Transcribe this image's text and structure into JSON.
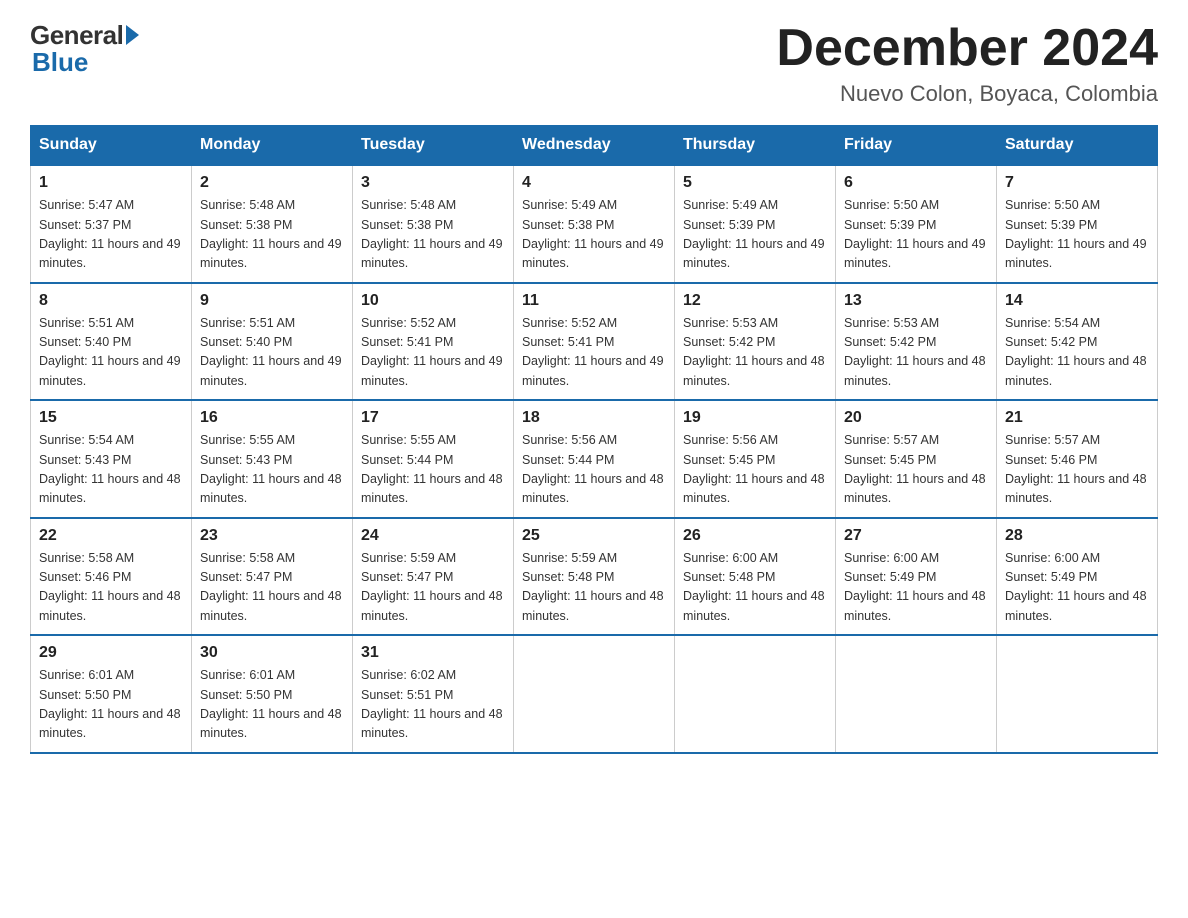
{
  "logo": {
    "general": "General",
    "blue": "Blue"
  },
  "title": "December 2024",
  "location": "Nuevo Colon, Boyaca, Colombia",
  "days_of_week": [
    "Sunday",
    "Monday",
    "Tuesday",
    "Wednesday",
    "Thursday",
    "Friday",
    "Saturday"
  ],
  "weeks": [
    [
      {
        "day": "1",
        "sunrise": "5:47 AM",
        "sunset": "5:37 PM",
        "daylight": "11 hours and 49 minutes."
      },
      {
        "day": "2",
        "sunrise": "5:48 AM",
        "sunset": "5:38 PM",
        "daylight": "11 hours and 49 minutes."
      },
      {
        "day": "3",
        "sunrise": "5:48 AM",
        "sunset": "5:38 PM",
        "daylight": "11 hours and 49 minutes."
      },
      {
        "day": "4",
        "sunrise": "5:49 AM",
        "sunset": "5:38 PM",
        "daylight": "11 hours and 49 minutes."
      },
      {
        "day": "5",
        "sunrise": "5:49 AM",
        "sunset": "5:39 PM",
        "daylight": "11 hours and 49 minutes."
      },
      {
        "day": "6",
        "sunrise": "5:50 AM",
        "sunset": "5:39 PM",
        "daylight": "11 hours and 49 minutes."
      },
      {
        "day": "7",
        "sunrise": "5:50 AM",
        "sunset": "5:39 PM",
        "daylight": "11 hours and 49 minutes."
      }
    ],
    [
      {
        "day": "8",
        "sunrise": "5:51 AM",
        "sunset": "5:40 PM",
        "daylight": "11 hours and 49 minutes."
      },
      {
        "day": "9",
        "sunrise": "5:51 AM",
        "sunset": "5:40 PM",
        "daylight": "11 hours and 49 minutes."
      },
      {
        "day": "10",
        "sunrise": "5:52 AM",
        "sunset": "5:41 PM",
        "daylight": "11 hours and 49 minutes."
      },
      {
        "day": "11",
        "sunrise": "5:52 AM",
        "sunset": "5:41 PM",
        "daylight": "11 hours and 49 minutes."
      },
      {
        "day": "12",
        "sunrise": "5:53 AM",
        "sunset": "5:42 PM",
        "daylight": "11 hours and 48 minutes."
      },
      {
        "day": "13",
        "sunrise": "5:53 AM",
        "sunset": "5:42 PM",
        "daylight": "11 hours and 48 minutes."
      },
      {
        "day": "14",
        "sunrise": "5:54 AM",
        "sunset": "5:42 PM",
        "daylight": "11 hours and 48 minutes."
      }
    ],
    [
      {
        "day": "15",
        "sunrise": "5:54 AM",
        "sunset": "5:43 PM",
        "daylight": "11 hours and 48 minutes."
      },
      {
        "day": "16",
        "sunrise": "5:55 AM",
        "sunset": "5:43 PM",
        "daylight": "11 hours and 48 minutes."
      },
      {
        "day": "17",
        "sunrise": "5:55 AM",
        "sunset": "5:44 PM",
        "daylight": "11 hours and 48 minutes."
      },
      {
        "day": "18",
        "sunrise": "5:56 AM",
        "sunset": "5:44 PM",
        "daylight": "11 hours and 48 minutes."
      },
      {
        "day": "19",
        "sunrise": "5:56 AM",
        "sunset": "5:45 PM",
        "daylight": "11 hours and 48 minutes."
      },
      {
        "day": "20",
        "sunrise": "5:57 AM",
        "sunset": "5:45 PM",
        "daylight": "11 hours and 48 minutes."
      },
      {
        "day": "21",
        "sunrise": "5:57 AM",
        "sunset": "5:46 PM",
        "daylight": "11 hours and 48 minutes."
      }
    ],
    [
      {
        "day": "22",
        "sunrise": "5:58 AM",
        "sunset": "5:46 PM",
        "daylight": "11 hours and 48 minutes."
      },
      {
        "day": "23",
        "sunrise": "5:58 AM",
        "sunset": "5:47 PM",
        "daylight": "11 hours and 48 minutes."
      },
      {
        "day": "24",
        "sunrise": "5:59 AM",
        "sunset": "5:47 PM",
        "daylight": "11 hours and 48 minutes."
      },
      {
        "day": "25",
        "sunrise": "5:59 AM",
        "sunset": "5:48 PM",
        "daylight": "11 hours and 48 minutes."
      },
      {
        "day": "26",
        "sunrise": "6:00 AM",
        "sunset": "5:48 PM",
        "daylight": "11 hours and 48 minutes."
      },
      {
        "day": "27",
        "sunrise": "6:00 AM",
        "sunset": "5:49 PM",
        "daylight": "11 hours and 48 minutes."
      },
      {
        "day": "28",
        "sunrise": "6:00 AM",
        "sunset": "5:49 PM",
        "daylight": "11 hours and 48 minutes."
      }
    ],
    [
      {
        "day": "29",
        "sunrise": "6:01 AM",
        "sunset": "5:50 PM",
        "daylight": "11 hours and 48 minutes."
      },
      {
        "day": "30",
        "sunrise": "6:01 AM",
        "sunset": "5:50 PM",
        "daylight": "11 hours and 48 minutes."
      },
      {
        "day": "31",
        "sunrise": "6:02 AM",
        "sunset": "5:51 PM",
        "daylight": "11 hours and 48 minutes."
      },
      null,
      null,
      null,
      null
    ]
  ],
  "labels": {
    "sunrise": "Sunrise:",
    "sunset": "Sunset:",
    "daylight": "Daylight:"
  }
}
